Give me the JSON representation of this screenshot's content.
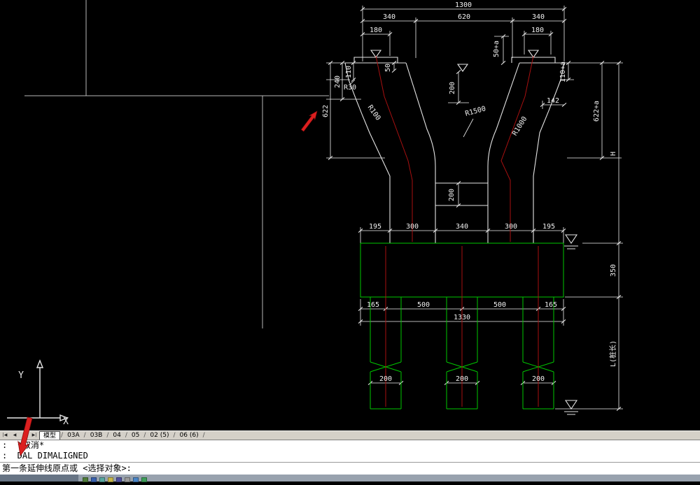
{
  "colors": {
    "background": "#000000",
    "cad_outline": "#e4e4e4",
    "cad_dimension": "#f0f0f0",
    "cad_green": "#00c800",
    "cad_centerline_red": "#a81010",
    "cursor_arrow_red": "#dc1f1f",
    "tab_bar_bg": "#d4d0c8",
    "command_bg": "#ffffff"
  },
  "drawing": {
    "labels": {
      "n1300": "1300",
      "t340l": "340",
      "t620": "620",
      "t340r": "340",
      "t180l": "180",
      "t180r": "180",
      "v110": "110",
      "v240": "240",
      "v622": "622",
      "r30": "R30",
      "r100": "R100",
      "v50": "50",
      "v200c": "200",
      "v50a": "50+a",
      "v110a": "110+a",
      "h142": "142",
      "r1500": "R1500",
      "r1000": "R1000",
      "v622a": "622+a",
      "vH": "H",
      "v200m": "200",
      "b195l": "195",
      "b300l": "300",
      "b340": "340",
      "b300r": "300",
      "b195r": "195",
      "v350": "350",
      "c165l": "165",
      "c500l": "500",
      "c500r": "500",
      "c165r": "165",
      "n1330": "1330",
      "p200a": "200",
      "p200b": "200",
      "p200c": "200",
      "vL": "L(桩长)"
    },
    "ucs": {
      "x": "X",
      "y": "Y"
    }
  },
  "tab_bar": {
    "nav": [
      "|◀",
      "◀",
      "▶",
      "▶|"
    ],
    "tabs": [
      "模型",
      "03A",
      "03B",
      "04",
      "05",
      "02 (5)",
      "06 (6)"
    ],
    "separator": "/"
  },
  "command": {
    "history": [
      ":  *取消*",
      ":  DAL DIMALIGNED"
    ],
    "prompt": "第一条延伸线原点或 <选择对象>:"
  },
  "taskbar": {
    "icon_colors": [
      "#4f7d3a",
      "#3a62b0",
      "#58a8a0",
      "#c8b84a",
      "#5050a0",
      "#9a9a9a",
      "#4a86c8",
      "#3fa05a"
    ]
  }
}
